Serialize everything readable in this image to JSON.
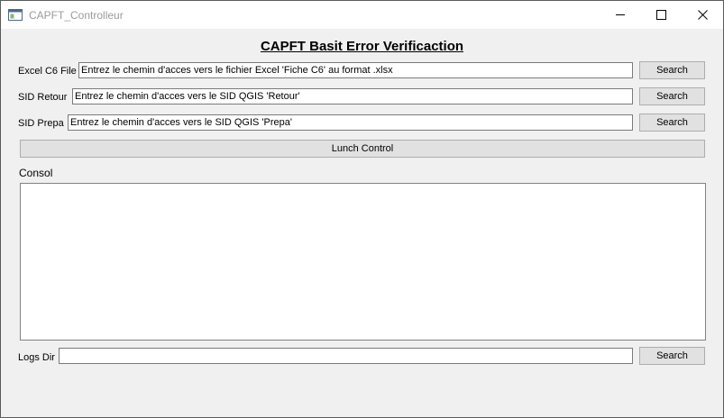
{
  "window": {
    "title": "CAPFT_Controlleur",
    "icon": "app-window-icon",
    "controls": {
      "minimize": "minimize-icon",
      "maximize": "maximize-icon",
      "close": "close-icon"
    }
  },
  "heading": "CAPFT Basit Error Verificaction",
  "form": {
    "excel": {
      "label": "Excel C6 File",
      "placeholder": "Entrez le chemin d'acces vers le fichier Excel 'Fiche C6' au format .xlsx",
      "button": "Search"
    },
    "sid_retour": {
      "label": "SID Retour",
      "placeholder": "Entrez le chemin d'acces vers le SID QGIS 'Retour'",
      "button": "Search"
    },
    "sid_prepa": {
      "label": "SID Prepa",
      "placeholder": "Entrez le chemin d'acces vers le SID QGIS 'Prepa'",
      "button": "Search"
    }
  },
  "launch_button": "Lunch Control",
  "console": {
    "label": "Consol",
    "value": ""
  },
  "logs": {
    "label": "Logs Dir",
    "value": "",
    "button": "Search"
  }
}
